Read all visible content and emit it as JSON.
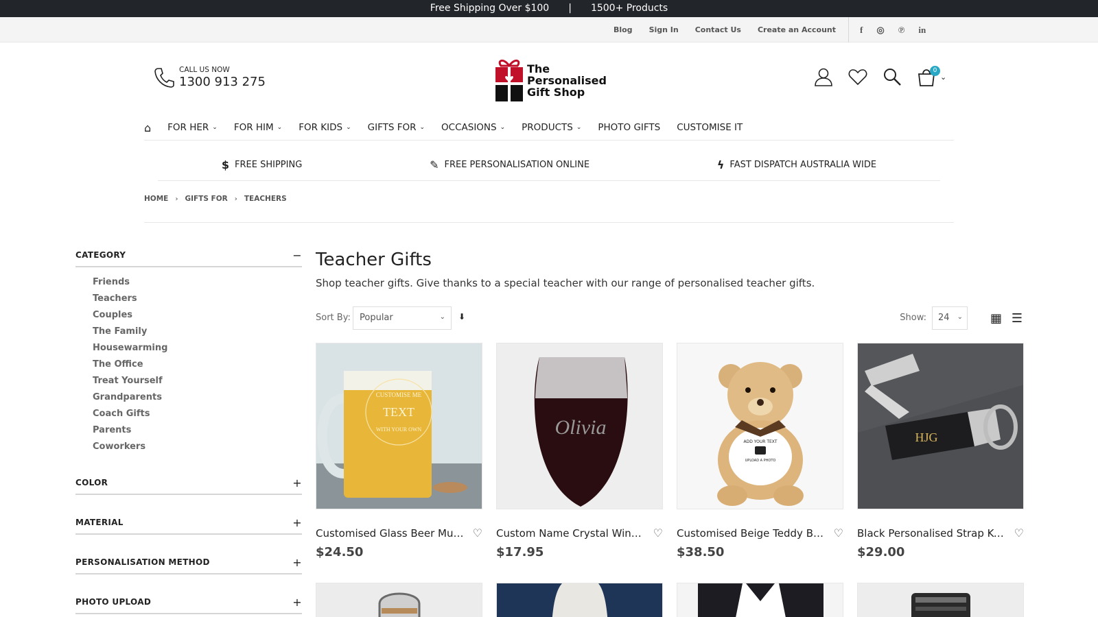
{
  "promo": {
    "shipping": "Free Shipping Over $100",
    "divider": "|",
    "products": "1500+ Products"
  },
  "toplinks": [
    "Blog",
    "Sign In",
    "Contact Us",
    "Create an Account"
  ],
  "social": [
    {
      "icon": "facebook-icon",
      "glyph": "f"
    },
    {
      "icon": "instagram-icon",
      "glyph": "◎"
    },
    {
      "icon": "pinterest-icon",
      "glyph": "℗"
    },
    {
      "icon": "linkedin-icon",
      "glyph": "in"
    }
  ],
  "call": {
    "label": "CALL US NOW",
    "number": "1300 913 275"
  },
  "logo": {
    "line1": "The",
    "line2": "Personalised",
    "line3": "Gift Shop"
  },
  "cart": {
    "count": "0"
  },
  "nav": [
    {
      "label": "FOR HER",
      "chevron": true
    },
    {
      "label": "FOR HIM",
      "chevron": true
    },
    {
      "label": "FOR KIDS",
      "chevron": true
    },
    {
      "label": "GIFTS FOR",
      "chevron": true
    },
    {
      "label": "OCCASIONS",
      "chevron": true
    },
    {
      "label": "PRODUCTS",
      "chevron": true
    },
    {
      "label": "PHOTO GIFTS",
      "chevron": false
    },
    {
      "label": "CUSTOMISE IT",
      "chevron": false
    }
  ],
  "features": [
    {
      "icon": "dollar-icon",
      "glyph": "$",
      "label": "FREE SHIPPING"
    },
    {
      "icon": "magic-wand-icon",
      "glyph": "✎",
      "label": "FREE PERSONALISATION ONLINE"
    },
    {
      "icon": "bolt-icon",
      "glyph": "ϟ",
      "label": "FAST DISPATCH AUSTRALIA WIDE"
    }
  ],
  "breadcrumb": [
    "HOME",
    "GIFTS FOR",
    "TEACHERS"
  ],
  "sidebar": {
    "category": {
      "title": "CATEGORY",
      "toggle": "−",
      "items": [
        "Friends",
        "Teachers",
        "Couples",
        "The Family",
        "Housewarming",
        "The Office",
        "Treat Yourself",
        "Grandparents",
        "Coach Gifts",
        "Parents",
        "Coworkers"
      ]
    },
    "filters": [
      {
        "title": "COLOR",
        "toggle": "+"
      },
      {
        "title": "MATERIAL",
        "toggle": "+"
      },
      {
        "title": "PERSONALISATION METHOD",
        "toggle": "+"
      },
      {
        "title": "PHOTO UPLOAD",
        "toggle": "+"
      }
    ]
  },
  "main": {
    "title": "Teacher Gifts",
    "description": "Shop teacher gifts. Give thanks to a special teacher with our range of personalised teacher gifts."
  },
  "toolbar": {
    "sort_label": "Sort By:",
    "sort_value": "Popular",
    "show_label": "Show:",
    "show_value": "24"
  },
  "products": [
    {
      "name": "Customised Glass Beer Mug ...",
      "price": "$24.50",
      "img_text": "TEXT",
      "arc_top": "CUSTOMISE ME",
      "arc_bottom": "WITH YOUR OWN"
    },
    {
      "name": "Custom Name Crystal Wine ...",
      "price": "$17.95",
      "img_text": "Olivia"
    },
    {
      "name": "Customised Beige Teddy Bear",
      "price": "$38.50",
      "img_text": "ADD YOUR TEXT",
      "img_sub": "UPLOAD A PHOTO"
    },
    {
      "name": "Black Personalised Strap Key...",
      "price": "$29.00",
      "img_text": "HJG"
    }
  ]
}
